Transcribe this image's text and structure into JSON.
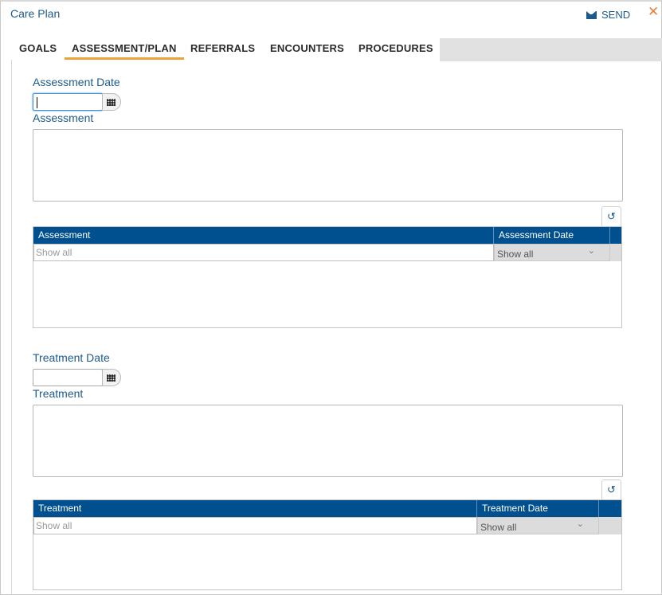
{
  "window": {
    "title": "Care Plan"
  },
  "header": {
    "send_label": "SEND",
    "close_glyph": "✕"
  },
  "tabs": [
    {
      "label": "GOALS",
      "active": false
    },
    {
      "label": "ASSESSMENT/PLAN",
      "active": true
    },
    {
      "label": "REFERRALS",
      "active": false
    },
    {
      "label": "ENCOUNTERS",
      "active": false
    },
    {
      "label": "PROCEDURES",
      "active": false
    }
  ],
  "assessment": {
    "date_label": "Assessment Date",
    "date_value": "",
    "text_label": "Assessment",
    "text_value": "",
    "grid": {
      "columns": [
        "Assessment",
        "Assessment Date"
      ],
      "filter_placeholder": "Show all",
      "filter_select": "Show all"
    }
  },
  "treatment": {
    "date_label": "Treatment Date",
    "date_value": "",
    "text_label": "Treatment",
    "text_value": "",
    "grid": {
      "columns": [
        "Treatment",
        "Treatment Date"
      ],
      "filter_placeholder": "Show all",
      "filter_select": "Show all"
    }
  },
  "icons": {
    "send": "mail-icon",
    "close": "close-icon",
    "calendar": "calendar-icon",
    "refresh": "refresh-icon",
    "chevron": "chevron-down-icon"
  },
  "colors": {
    "accent": "#1d5a8c",
    "grid_header": "#00508f",
    "tab_underline": "#e9a33b",
    "close": "#e8803a"
  }
}
